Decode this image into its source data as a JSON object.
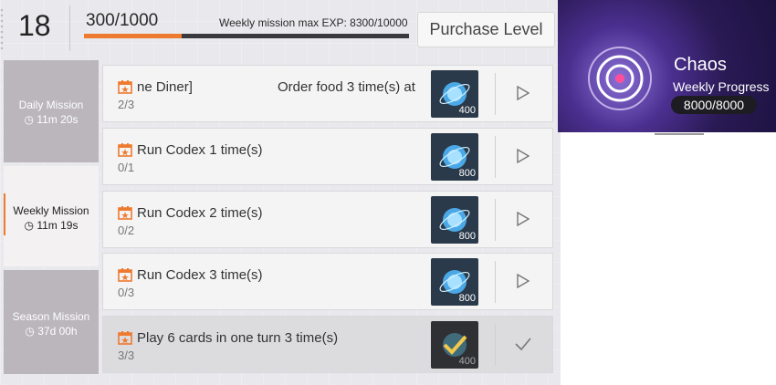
{
  "header": {
    "level": "18",
    "exp": "300/1000",
    "exp_fraction": 0.3,
    "weekly_max_exp": "Weekly mission max EXP: 8300/10000",
    "purchase_label": "Purchase Level",
    "accent_color": "#ee7a2f"
  },
  "tabs": [
    {
      "label": "Daily Mission",
      "timer": "11m 20s",
      "state": "inactive"
    },
    {
      "label": "Weekly Mission",
      "timer": "11m 19s",
      "state": "active"
    },
    {
      "label": "Season Mission",
      "timer": "37d 00h",
      "state": "inactive"
    }
  ],
  "missions": [
    {
      "title": "ne Diner]",
      "title_right": "Order food 3 time(s) at",
      "progress": "2/3",
      "reward": "400",
      "action": "play",
      "done": false
    },
    {
      "title": "Run Codex 1 time(s)",
      "progress": "0/1",
      "reward": "800",
      "action": "play",
      "done": false
    },
    {
      "title": "Run Codex 2 time(s)",
      "progress": "0/2",
      "reward": "800",
      "action": "play",
      "done": false
    },
    {
      "title": "Run Codex 3 time(s)",
      "progress": "0/3",
      "reward": "800",
      "action": "play",
      "done": false
    },
    {
      "title": "Play 6 cards in one turn 3 time(s)",
      "progress": "3/3",
      "reward": "400",
      "action": "check",
      "done": true
    }
  ],
  "side_panel": {
    "title": "Chaos",
    "subtitle": "Weekly Progress",
    "value": "8000/8000"
  },
  "icons": {
    "timer": "clock-icon",
    "calendar": "calendar-star-icon",
    "reward": "exp-orb-icon",
    "play": "play-triangle-icon",
    "check": "checkmark-icon"
  }
}
